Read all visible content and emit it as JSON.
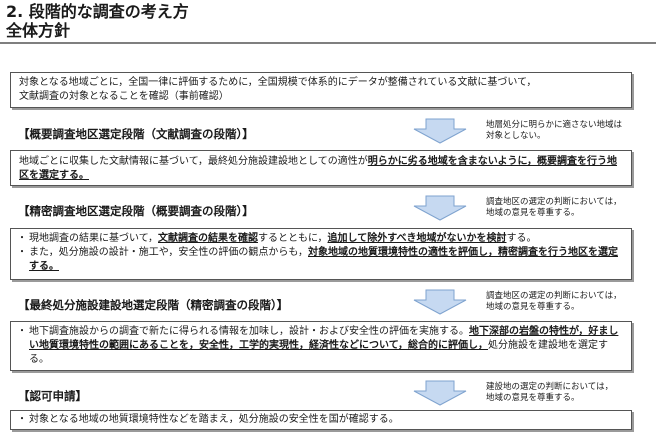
{
  "title": {
    "line1": "2. 段階的な調査の考え方",
    "line2": "全体方針"
  },
  "intro": {
    "line1": "対象となる地域ごとに，全国一律に評価するために，全国規模で体系的にデータが整備されている文献に基づいて，",
    "line2": "文献調査の対象となることを確認（事前確認）"
  },
  "stages": [
    {
      "heading": "【概要調査地区選定段階（文献調査の段階）】",
      "note": [
        "地層処分に明らかに適さない地域は",
        "対象としない。"
      ],
      "bullets": [
        {
          "bullet": "",
          "parts": [
            {
              "t": "地域ごとに収集した文献情報に基づいて，最終処分施設建設地としての適性が",
              "h": false
            },
            {
              "t": "明らかに劣る地域を含まないように，概要調査を行う地区を選定する。",
              "h": true
            }
          ]
        }
      ]
    },
    {
      "heading": "【精密調査地区選定段階（概要調査の段階）】",
      "note": [
        "調査地区の選定の判断においては，",
        "地域の意見を尊重する。"
      ],
      "bullets": [
        {
          "bullet": "・",
          "parts": [
            {
              "t": "現地調査の結果に基づいて，",
              "h": false
            },
            {
              "t": "文献調査の結果を確認",
              "h": true
            },
            {
              "t": "するとともに，",
              "h": false
            },
            {
              "t": "追加して除外すべき地域がないかを検討",
              "h": true
            },
            {
              "t": "する。",
              "h": false
            }
          ]
        },
        {
          "bullet": "・",
          "parts": [
            {
              "t": "また，処分施設の設計・施工や，安全性の評価の観点からも，",
              "h": false
            },
            {
              "t": "対象地域の地質環境特性の適性を評価し，精密調査を行う地区を選定する。",
              "h": true
            }
          ]
        }
      ]
    },
    {
      "heading": "【最終処分施設建設地選定段階（精密調査の段階）】",
      "note": [
        "調査地区の選定の判断においては，",
        "地域の意見を尊重する。"
      ],
      "bullets": [
        {
          "bullet": "・",
          "parts": [
            {
              "t": "地下調査施設からの調査で新たに得られる情報を加味し，設計・および安全性の評価を実施する。",
              "h": false
            },
            {
              "t": "地下深部の岩盤の特性が，好ましい地質環境特性の範囲にあることを，安全性，工学的実現性，経済性などについて，総合的に評価し，",
              "h": true
            },
            {
              "t": "処分施設を建設地を選定する。",
              "h": false
            }
          ]
        }
      ]
    },
    {
      "heading": "【認可申請】",
      "note": [
        "建設地の選定の判断においては，",
        "地域の意見を尊重する。"
      ],
      "bullets": [
        {
          "bullet": "・",
          "parts": [
            {
              "t": "対象となる地域の地質環境特性などを踏まえ，処分施設の安全性を国が確認する。",
              "h": false
            }
          ]
        }
      ]
    }
  ],
  "colors": {
    "arrow_fill": "#c6d9f1",
    "arrow_stroke": "#7fa3cf",
    "rule": "#7f7f7f"
  }
}
